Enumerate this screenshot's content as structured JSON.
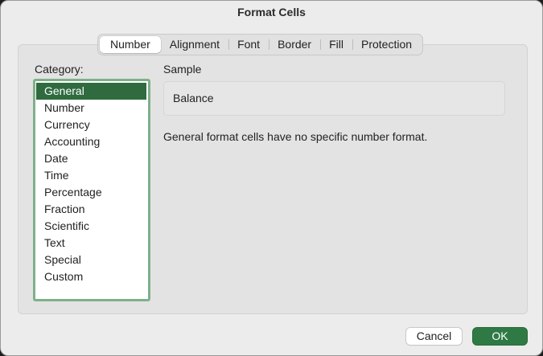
{
  "dialog": {
    "title": "Format Cells"
  },
  "tabs": [
    {
      "label": "Number",
      "active": true
    },
    {
      "label": "Alignment",
      "active": false
    },
    {
      "label": "Font",
      "active": false
    },
    {
      "label": "Border",
      "active": false
    },
    {
      "label": "Fill",
      "active": false
    },
    {
      "label": "Protection",
      "active": false
    }
  ],
  "category": {
    "label": "Category:",
    "selected": "General",
    "items": [
      "General",
      "Number",
      "Currency",
      "Accounting",
      "Date",
      "Time",
      "Percentage",
      "Fraction",
      "Scientific",
      "Text",
      "Special",
      "Custom"
    ]
  },
  "sample": {
    "label": "Sample",
    "value": "Balance"
  },
  "description": "General format cells have no specific number format.",
  "buttons": {
    "cancel_label": "Cancel",
    "ok_label": "OK"
  },
  "colors": {
    "accent": "#2f7a44",
    "selection": "#2f6b3f",
    "focus_ring": "#7fb08a"
  }
}
